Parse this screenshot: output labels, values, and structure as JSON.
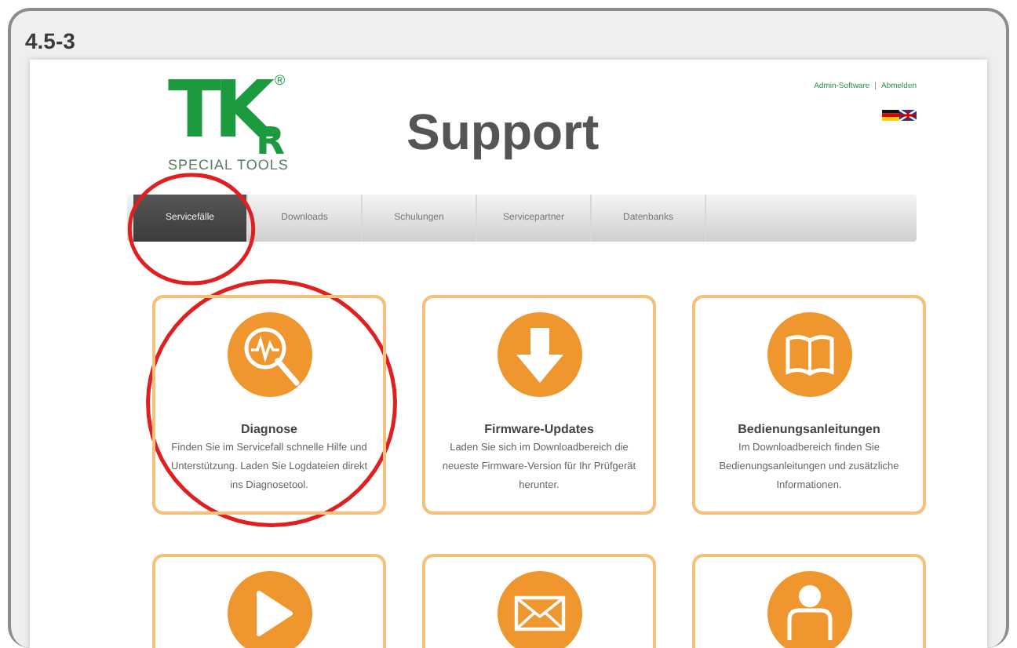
{
  "figure": {
    "label": "4.5-3"
  },
  "logo": {
    "mark": "TK",
    "sub": "R",
    "registered": "®",
    "tagline": "SPECIAL TOOLS"
  },
  "top_links": {
    "items": [
      "Admin-Software",
      "Abmelden"
    ],
    "separator": "|"
  },
  "title": "Support",
  "nav": [
    {
      "label": "Servicefälle",
      "selected": true,
      "highlighted": true
    },
    {
      "label": "Downloads",
      "selected": false,
      "highlighted": false
    },
    {
      "label": "Schulungen",
      "selected": false,
      "highlighted": false
    },
    {
      "label": "Servicepartner",
      "selected": false,
      "highlighted": false
    },
    {
      "label": "Datenbanks",
      "selected": false,
      "highlighted": false
    }
  ],
  "cards": [
    {
      "kind": "diagnose",
      "title": "Diagnose",
      "text": "Finden Sie im Servicefall schnelle Hilfe und Unterstützung. Laden Sie Logdateien direkt ins Diagnosetool.",
      "highlighted": true
    },
    {
      "kind": "download",
      "title": "Firmware-Updates",
      "text": "Laden Sie sich im Downloadbereich die neueste Firmware-Version für Ihr Prüfgerät herunter.",
      "highlighted": false
    },
    {
      "kind": "book",
      "title": "Bedienungsanleitungen",
      "text": "Im Downloadbereich finden Sie Bedienungsanleitungen und zusätzliche Informationen.",
      "highlighted": false
    },
    {
      "kind": "play",
      "highlighted": false
    },
    {
      "kind": "mail",
      "highlighted": false
    },
    {
      "kind": "person",
      "highlighted": false
    }
  ]
}
